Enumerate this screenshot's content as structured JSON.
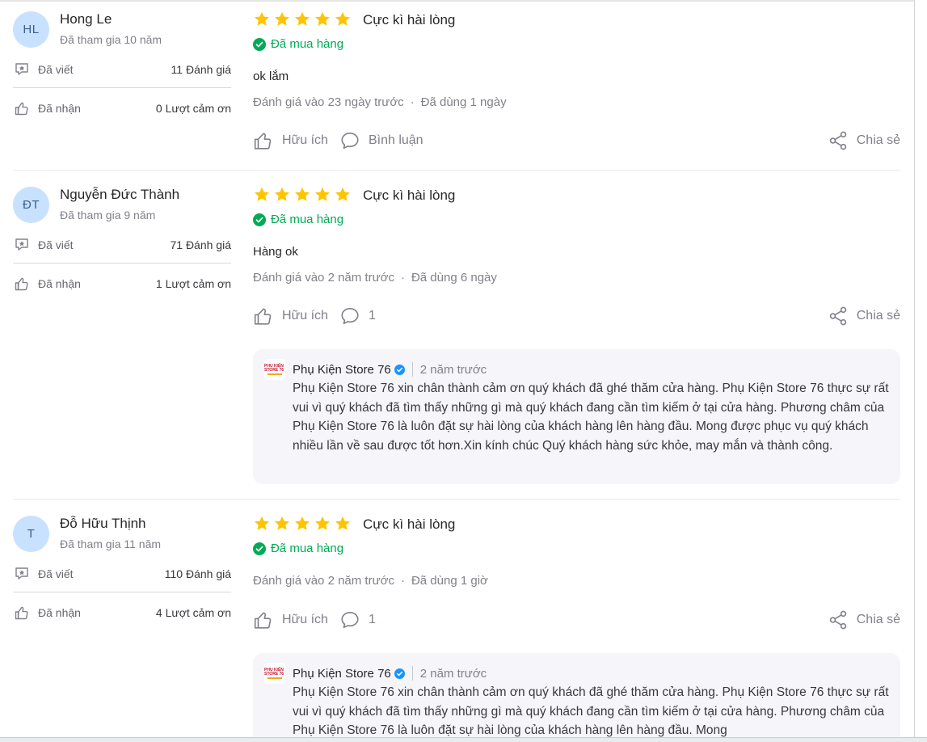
{
  "reviews": [
    {
      "initials": "HL",
      "name": "Hong Le",
      "joined": "Đã tham gia 10 năm",
      "written_label": "Đã viết",
      "written_value": "11 Đánh giá",
      "received_label": "Đã nhận",
      "received_value": "0 Lượt cảm ơn",
      "rating": 5,
      "title": "Cực kì hài lòng",
      "bought": "Đã mua hàng",
      "content": "ok lắm",
      "reviewed_at": "Đánh giá vào 23 ngày trước",
      "used_for": "Đã dùng 1 ngày",
      "helpful_label": "Hữu ích",
      "comment_label": "Bình luận",
      "share_label": "Chia sẻ"
    },
    {
      "initials": "ĐT",
      "name": "Nguyễn Đức Thành",
      "joined": "Đã tham gia 9 năm",
      "written_label": "Đã viết",
      "written_value": "71 Đánh giá",
      "received_label": "Đã nhận",
      "received_value": "1 Lượt cảm ơn",
      "rating": 5,
      "title": "Cực kì hài lòng",
      "bought": "Đã mua hàng",
      "content": "Hàng ok",
      "reviewed_at": "Đánh giá vào 2 năm trước",
      "used_for": "Đã dùng 6 ngày",
      "helpful_label": "Hữu ích",
      "comment_label": "1",
      "share_label": "Chia sẻ",
      "reply": {
        "logo_text": "PHỤ KIỆN STORE 76",
        "seller": "Phụ Kiện Store 76",
        "time": "2 năm trước",
        "text": "Phụ Kiện Store 76 xin chân thành cảm ơn quý khách đã ghé thăm cửa hàng. Phụ Kiện Store 76 thực sự rất vui vì quý khách đã tìm thấy những gì mà quý khách đang cần tìm kiếm ở tại cửa hàng. Phương châm của Phụ Kiện Store 76 là luôn đặt sự hài lòng của khách hàng lên hàng đầu. Mong được phục vụ quý khách nhiều lần về sau được tốt hơn.Xin kính chúc Quý khách hàng sức khỏe, may mắn và thành công."
      }
    },
    {
      "initials": "T",
      "name": "Đỗ Hữu Thịnh",
      "joined": "Đã tham gia 11 năm",
      "written_label": "Đã viết",
      "written_value": "110 Đánh giá",
      "received_label": "Đã nhận",
      "received_value": "4 Lượt cảm ơn",
      "rating": 5,
      "title": "Cực kì hài lòng",
      "bought": "Đã mua hàng",
      "reviewed_at": "Đánh giá vào 2 năm trước",
      "used_for": "Đã dùng 1 giờ",
      "helpful_label": "Hữu ích",
      "comment_label": "1",
      "share_label": "Chia sẻ",
      "reply": {
        "logo_text": "PHỤ KIỆN STORE 76",
        "seller": "Phụ Kiện Store 76",
        "time": "2 năm trước",
        "text": "Phụ Kiện Store 76 xin chân thành cảm ơn quý khách đã ghé thăm cửa hàng. Phụ Kiện Store 76 thực sự rất vui vì quý khách đã tìm thấy những gì mà quý khách đang cần tìm kiếm ở tại cửa hàng. Phương châm của Phụ Kiện Store 76 là luôn đặt sự hài lòng của khách hàng lên hàng đầu. Mong"
      }
    }
  ],
  "colors": {
    "star": "#ffc400",
    "bought": "#00ab56",
    "verified": "#1a94ff",
    "avatar_bg": "#c8e1ff"
  }
}
